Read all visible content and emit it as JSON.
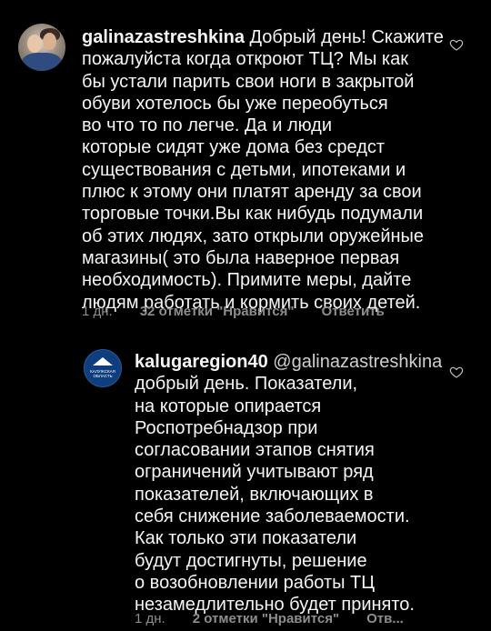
{
  "comments": [
    {
      "username": "galinazastreshkina",
      "text": " Добрый день! Скажите\nпожалуйста когда откроют ТЦ? Мы  как\nбы устали парить свои ноги в закрытой\nобуви хотелось бы уже переобуться\nво что то по легче. Да и  люди\nкоторые сидят уже дома  без средст\nсуществования с детьми, ипотеками и\nплюс к этому они платят аренду за свои\nторговые точки.Вы как нибудь подумали\nоб этих людях, зато открыли оружейные\nмагазины( это была наверное первая\nнеобходимость). Примите меры, дайте\nлюдям работать и кормить своих детей.",
      "time": "1 дн.",
      "likes": "32 отметки \"Нравится\"",
      "reply": "Ответить"
    },
    {
      "username": "kalugaregion40",
      "mention": "@galinazastreshkina",
      "text": "добрый день. Показатели,\nна которые опирается\nРоспотребнадзор при\nсогласовании этапов снятия\nограничений учитывают ряд\nпоказателей, включающих в\nсебя снижение заболеваемости.\nКак только эти показатели\nбудут достигнуты, решение\nо возобновлении работы ТЦ\nнезамедлительно будет принято.",
      "time": "1 дн.",
      "likes": "2 отметки \"Нравится\"",
      "reply": "Отв..."
    }
  ],
  "region_avatar_text": "КАЛУЖСКАЯ\nОБЛАСТЬ",
  "icons": [
    "heart-icon"
  ]
}
